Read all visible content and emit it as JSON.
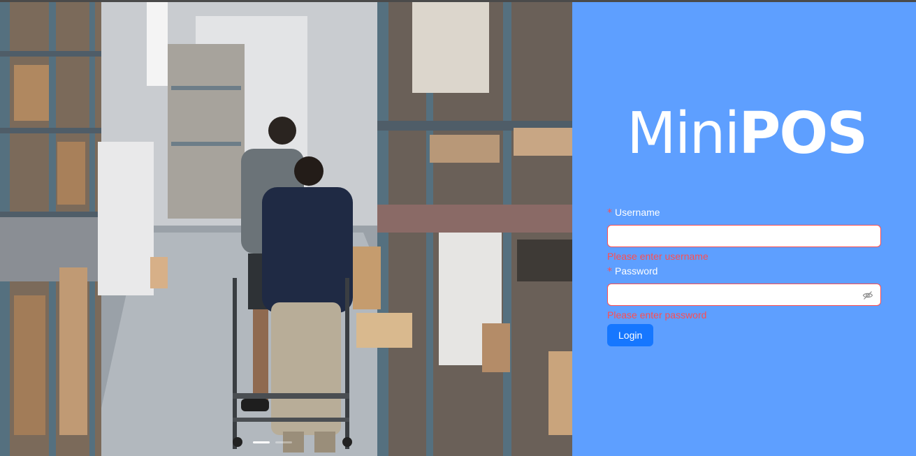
{
  "brand": {
    "name_light": "Mini",
    "name_bold": "POS"
  },
  "login_form": {
    "username": {
      "label": "Username",
      "required_mark": "*",
      "value": "",
      "error": "Please enter username"
    },
    "password": {
      "label": "Password",
      "required_mark": "*",
      "value": "",
      "error": "Please enter password",
      "toggle_icon": "eye-invisible-icon"
    },
    "submit_label": "Login"
  },
  "carousel": {
    "slide_count": 2,
    "active_index": 0,
    "image": "warehouse-aisle-photo"
  },
  "colors": {
    "panel_bg": "#5e9fff",
    "primary_button": "#1677ff",
    "error": "#ff4d4f",
    "text_light": "#ffffff"
  }
}
